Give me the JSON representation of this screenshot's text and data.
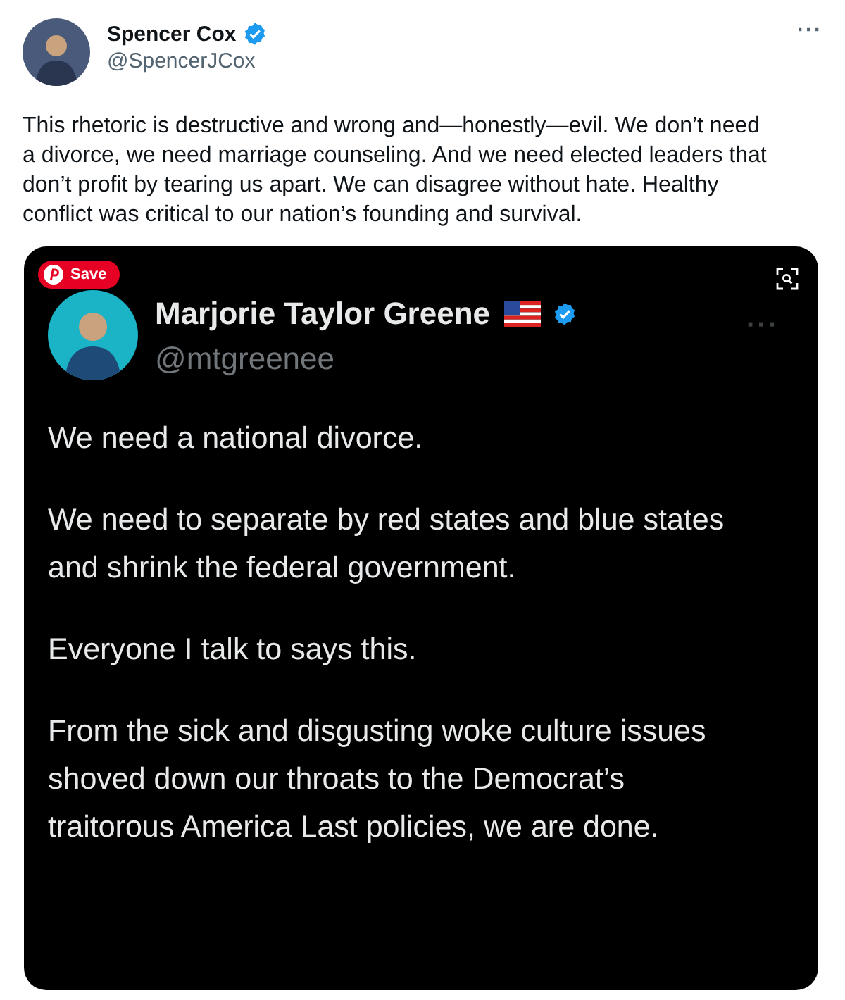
{
  "author": {
    "name": "Spencer Cox",
    "verified": true,
    "handle": "@SpencerJCox",
    "more": "···"
  },
  "text": "This rhetoric is destructive and wrong and—honestly—evil. We don’t need a divorce, we need marriage counseling. And we need elected leaders that don’t profit by tearing us apart. We can disagree without hate. Healthy conflict was critical to our nation’s founding and survival.",
  "image": {
    "save_button": "Save",
    "quoted": {
      "name": "Marjorie Taylor Greene",
      "verified": true,
      "handle": "@mtgreenee",
      "more": "···",
      "paragraphs": [
        "We need a national divorce.",
        "We need to separate by red states and blue states and shrink the federal government.",
        "Everyone I talk to says this.",
        "From the sick and disgusting woke culture issues shoved down our throats to the Democrat’s traitorous America Last policies, we are done."
      ]
    }
  }
}
